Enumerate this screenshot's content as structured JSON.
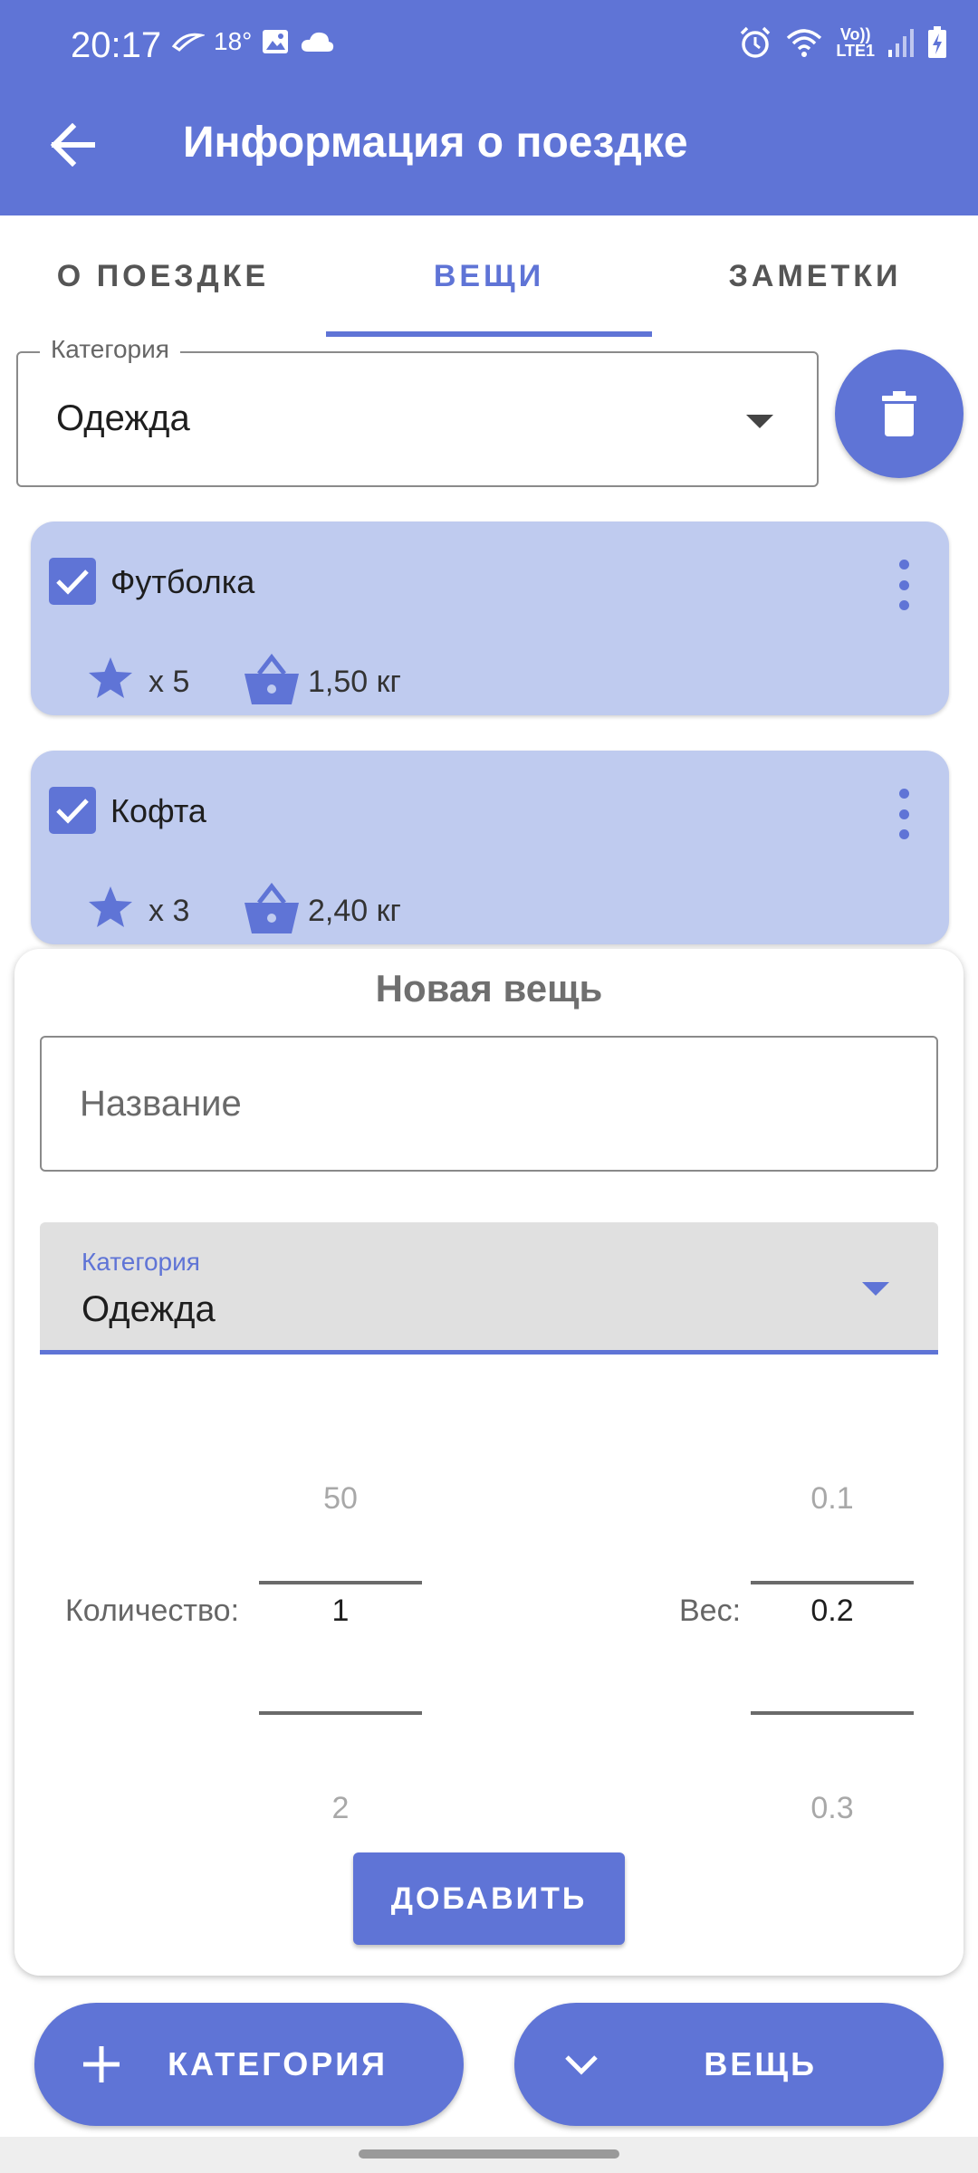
{
  "status_bar": {
    "time": "20:17",
    "temperature": "18°",
    "network_label_top": "Vo))",
    "network_label_bottom": "LTE1"
  },
  "appbar": {
    "title": "Информация о поездке",
    "back_icon": "arrow-back-icon",
    "color": "#5f74d6"
  },
  "tabs": [
    {
      "label": "О ПОЕЗДКЕ",
      "active": false
    },
    {
      "label": "ВЕЩИ",
      "active": true
    },
    {
      "label": "ЗАМЕТКИ",
      "active": false
    }
  ],
  "category_selector": {
    "legend": "Категория",
    "value": "Одежда"
  },
  "items": [
    {
      "name": "Футболка",
      "checked": true,
      "quantity": "x 5",
      "weight": "1,50 кг"
    },
    {
      "name": "Кофта",
      "checked": true,
      "quantity": "x 3",
      "weight": "2,40 кг"
    }
  ],
  "new_item": {
    "title": "Новая вещь",
    "name_placeholder": "Название",
    "category_label": "Категория",
    "category_value": "Одежда",
    "quantity_label": "Количество:",
    "quantity_prev": "50",
    "quantity_selected": "1",
    "quantity_next": "2",
    "weight_label": "Вес:",
    "weight_prev": "0.1",
    "weight_selected": "0.2",
    "weight_next": "0.3",
    "add_button": "ДОБАВИТЬ"
  },
  "bottom_buttons": {
    "category_label": "КАТЕГОРИЯ",
    "item_label": "ВЕЩЬ"
  },
  "colors": {
    "primary": "#5f74d6",
    "card": "#bfcbef"
  }
}
